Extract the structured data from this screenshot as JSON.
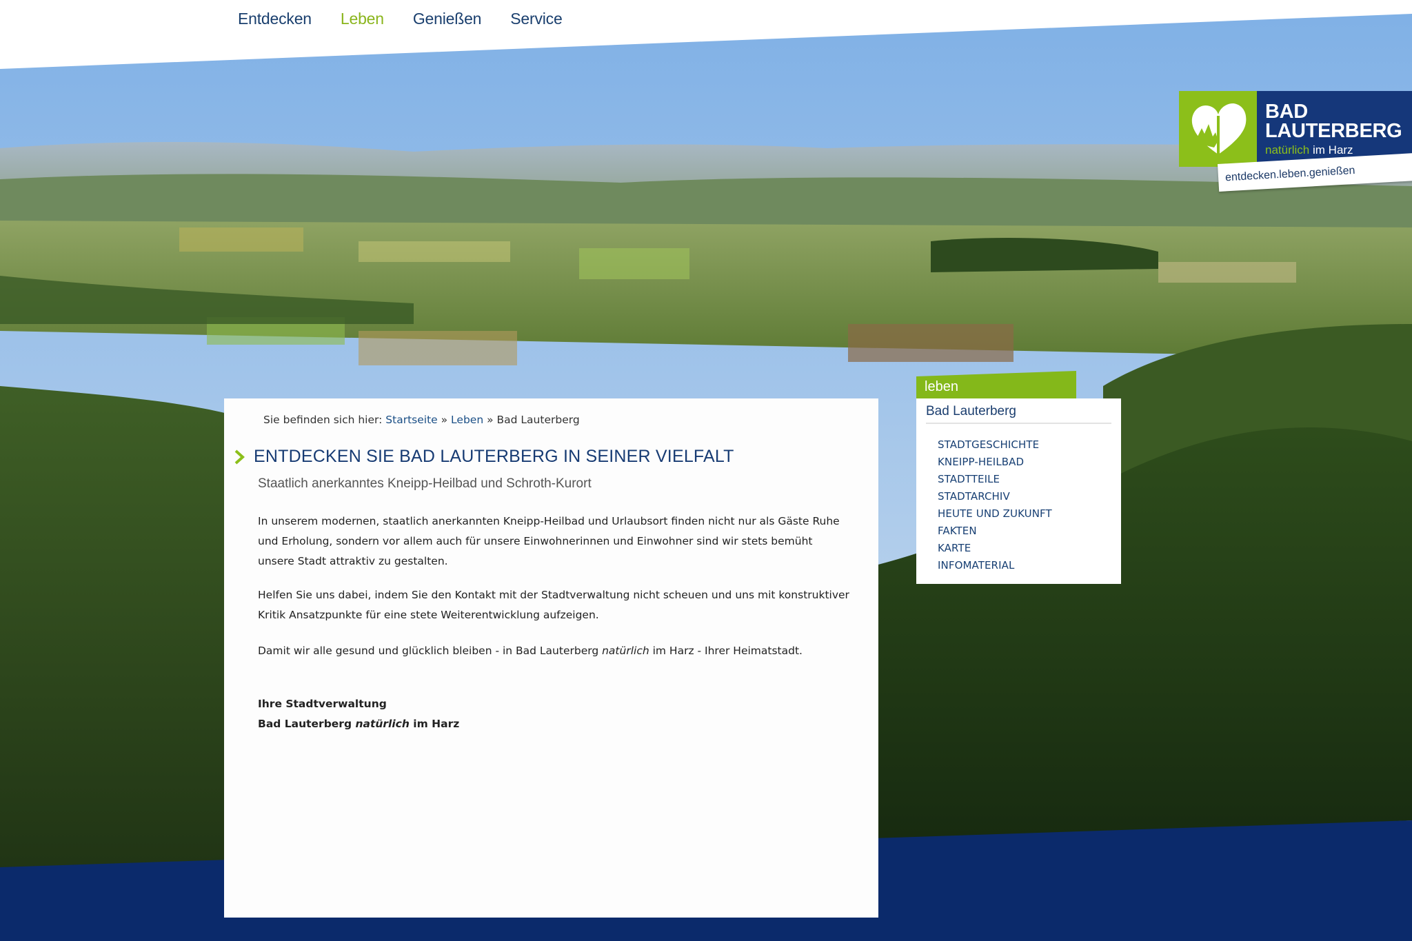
{
  "topnav": {
    "items": [
      "Entdecken",
      "Leben",
      "Genießen",
      "Service"
    ],
    "active": "Leben"
  },
  "logo": {
    "line1": "BAD",
    "line2": "LAUTERBERG",
    "tag_green": "natürlich",
    "tag_white": "im Harz",
    "slogan": "entdecken.leben.genießen"
  },
  "breadcrumb": {
    "prefix": "Sie befinden sich hier:",
    "items": [
      "Startseite",
      "Leben",
      "Bad Lauterberg"
    ],
    "separator": "»"
  },
  "content": {
    "heading": "ENTDECKEN SIE BAD LAUTERBERG IN SEINER VIELFALT",
    "subheading": "Staatlich anerkanntes Kneipp-Heilbad und Schroth-Kurort",
    "paragraph1": "In unserem modernen, staatlich anerkannten Kneipp-Heilbad und Urlaubsort finden nicht nur als Gäste Ruhe und Erholung, sondern vor allem auch für unsere Einwohnerinnen und Einwohner sind wir stets bemüht unsere Stadt attraktiv zu gestalten.",
    "paragraph2": "Helfen Sie uns dabei, indem Sie den Kontakt mit der Stadtverwaltung nicht scheuen und uns mit konstruktiver Kritik Ansatzpunkte für eine stete Weiterentwicklung aufzeigen.",
    "paragraph3_before": "Damit wir alle gesund und glücklich bleiben - in Bad Lauterberg ",
    "paragraph3_italic": "natürlich",
    "paragraph3_after": " im Harz - Ihrer Heimatstadt.",
    "signature_line1": "Ihre Stadtverwaltung",
    "signature_line2_before": "Bad Lauterberg ",
    "signature_line2_italic": "natürlich",
    "signature_line2_after": " im Harz"
  },
  "sidenav": {
    "tab": "leben",
    "title": "Bad Lauterberg",
    "items": [
      "STADTGESCHICHTE",
      "KNEIPP-HEILBAD",
      "STADTTEILE",
      "STADTARCHIV",
      "HEUTE UND ZUKUNFT",
      "FAKTEN",
      "KARTE",
      "INFOMATERIAL"
    ]
  },
  "colors": {
    "brand_blue": "#15377a",
    "brand_green": "#8cbf1a",
    "footer_band": "#0b2a6b"
  }
}
